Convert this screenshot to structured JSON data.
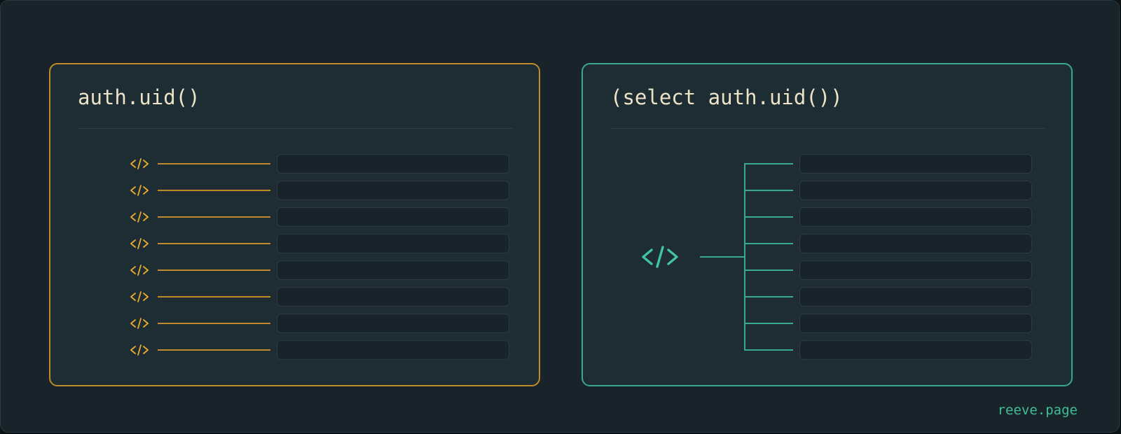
{
  "colors": {
    "left_accent": "#c08a2a",
    "left_icon": "#e9a92e",
    "right_accent": "#3aa88c",
    "right_icon": "#42c4a0"
  },
  "left_panel": {
    "title": "auth.uid()",
    "icon": "code-icon",
    "row_count": 8
  },
  "right_panel": {
    "title": "(select auth.uid())",
    "icon": "code-icon",
    "row_count": 8
  },
  "footer": {
    "site_label": "reeve.page"
  }
}
